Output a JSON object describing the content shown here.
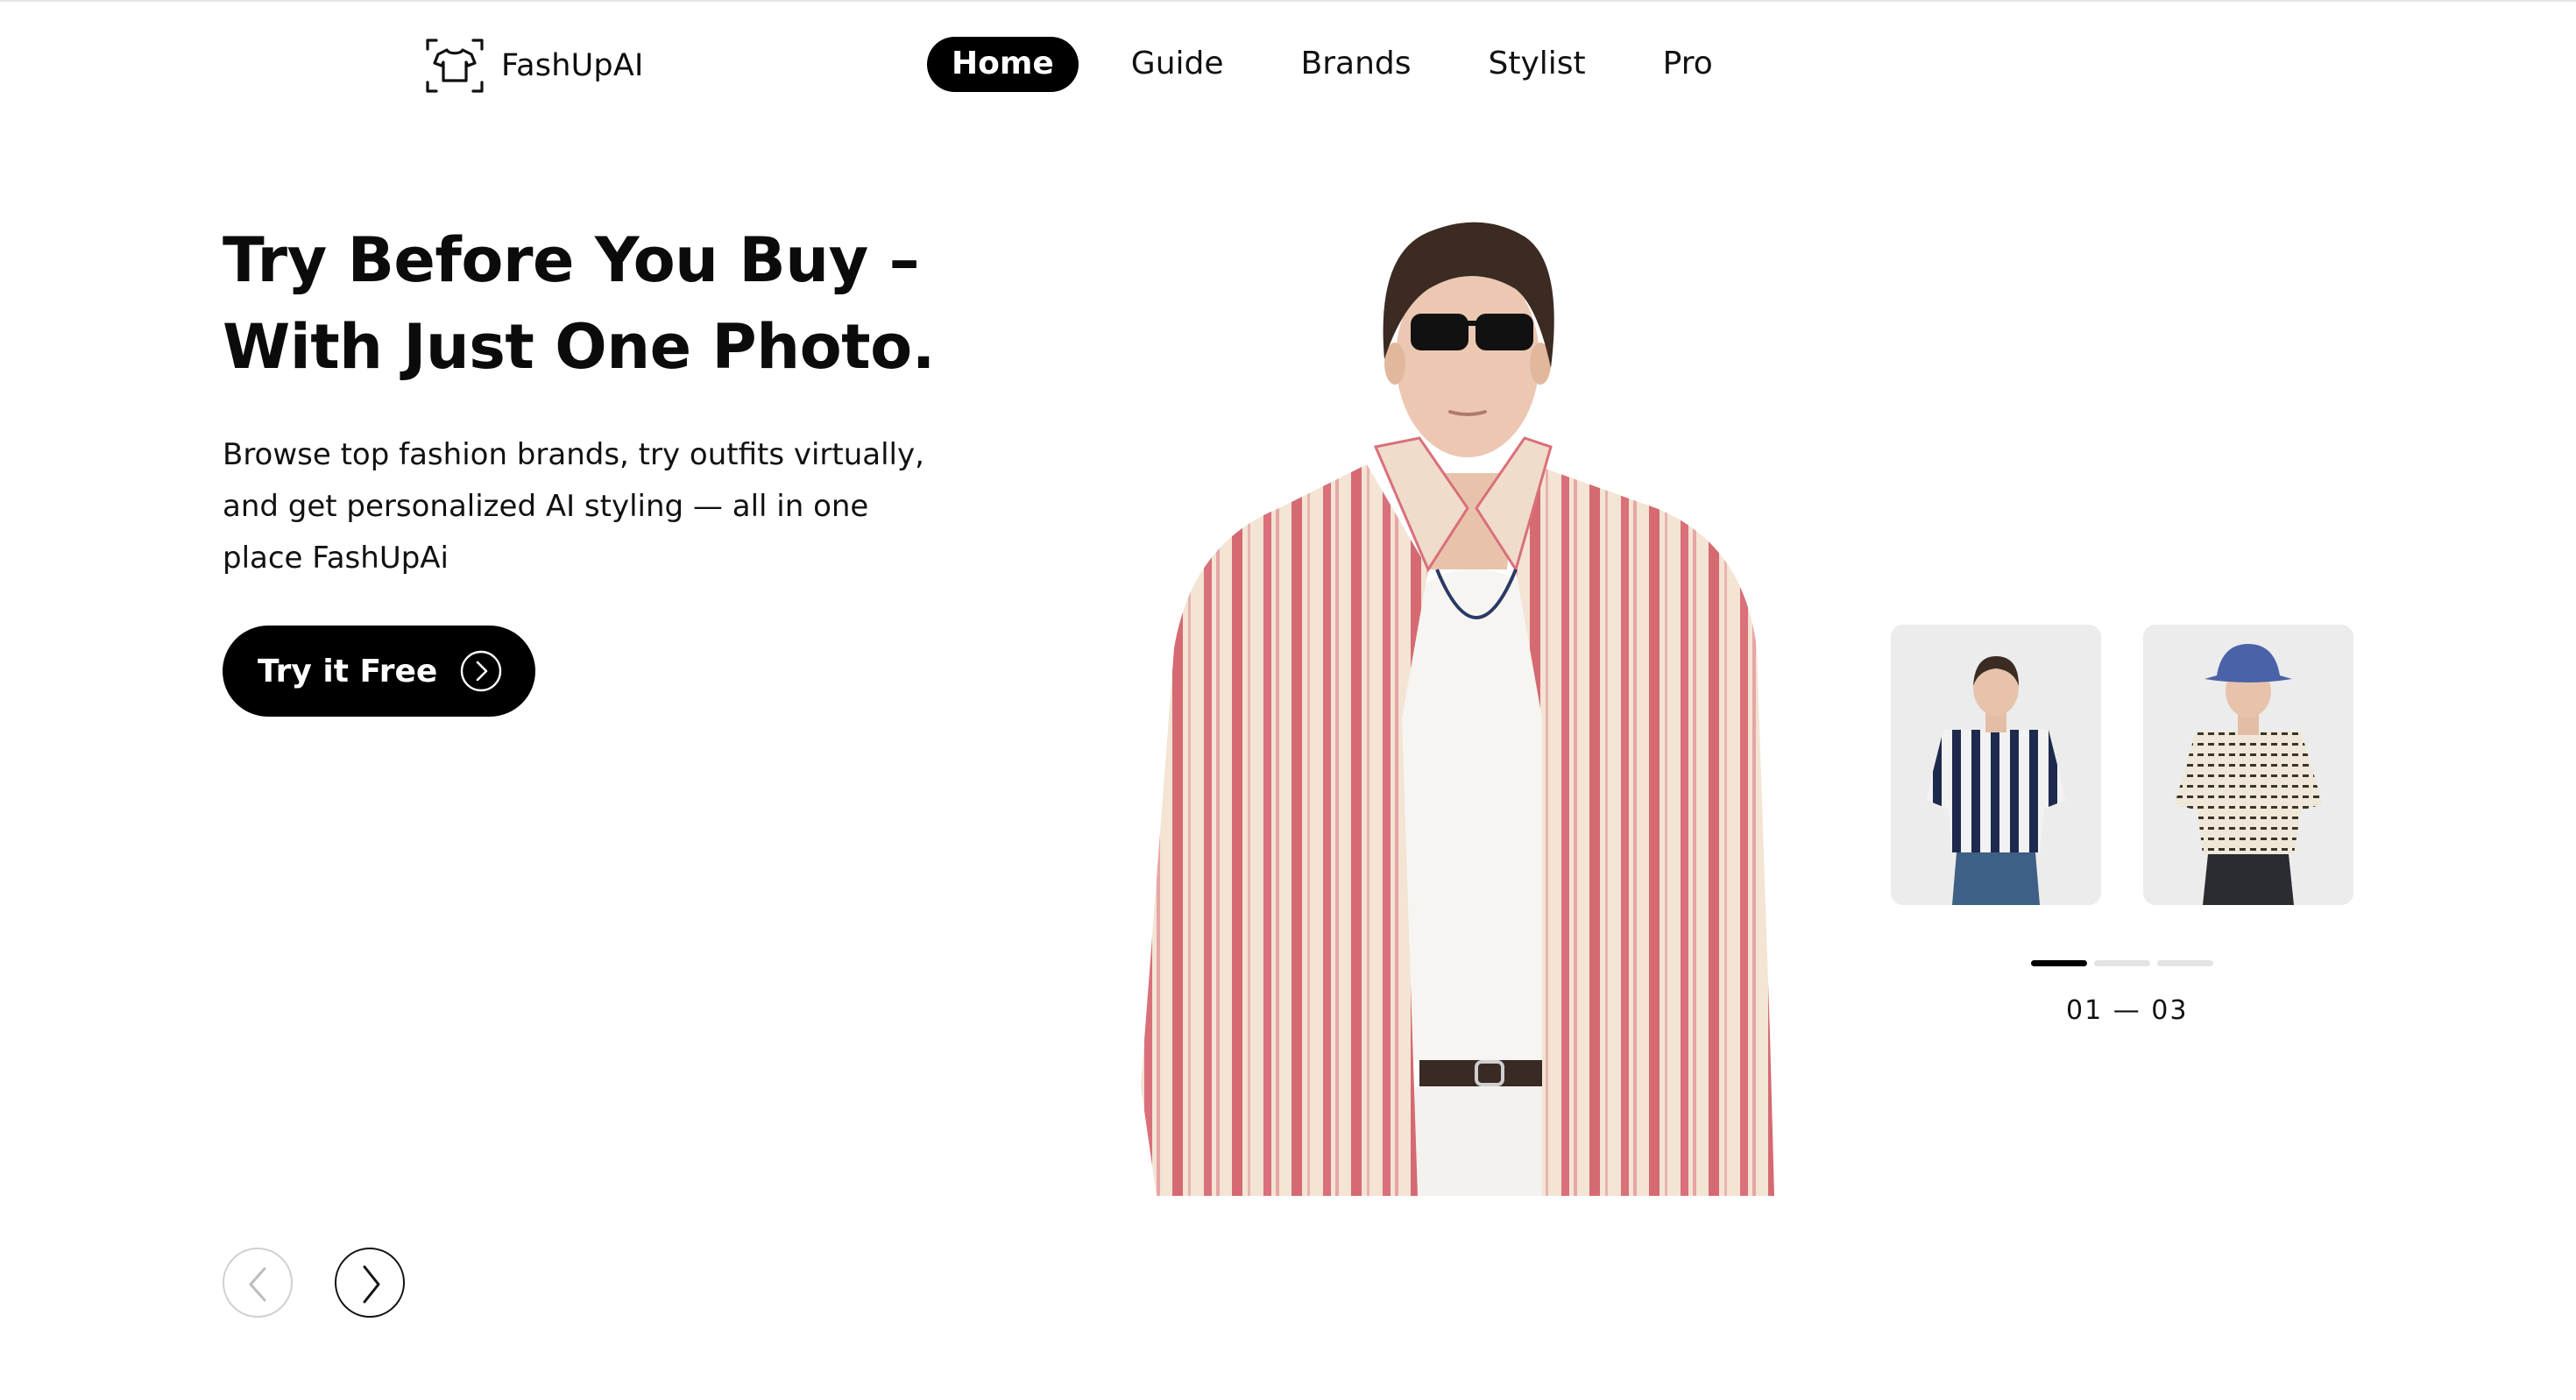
{
  "brand": {
    "name": "FashUpAI",
    "logo_icon": "tshirt-scan-icon"
  },
  "nav": {
    "items": [
      {
        "label": "Home",
        "active": true
      },
      {
        "label": "Guide",
        "active": false
      },
      {
        "label": "Brands",
        "active": false
      },
      {
        "label": "Stylist",
        "active": false
      },
      {
        "label": "Pro",
        "active": false
      }
    ]
  },
  "hero": {
    "headline_line1": "Try Before You Buy –",
    "headline_line2": "With Just One Photo.",
    "description": "Browse top fashion brands, try outfits virtually, and get personalized AI styling — all in one place FashUpAi",
    "cta_label": "Try it Free",
    "cta_icon": "chevron-right-circle-icon",
    "image_alt": "model-striped-shirt"
  },
  "carousel": {
    "thumbnails": [
      {
        "alt": "model-navy-striped-shirt"
      },
      {
        "alt": "model-crochet-shirt-bucket-hat"
      }
    ],
    "progress": {
      "current": 1,
      "total": 3
    },
    "counter_text": "01 — 03",
    "prev_icon": "chevron-left-icon",
    "next_icon": "chevron-right-icon"
  },
  "colors": {
    "accent": "#000000",
    "background": "#ffffff",
    "stripe_red": "#d9707a",
    "stripe_navy": "#1e2a4d"
  }
}
